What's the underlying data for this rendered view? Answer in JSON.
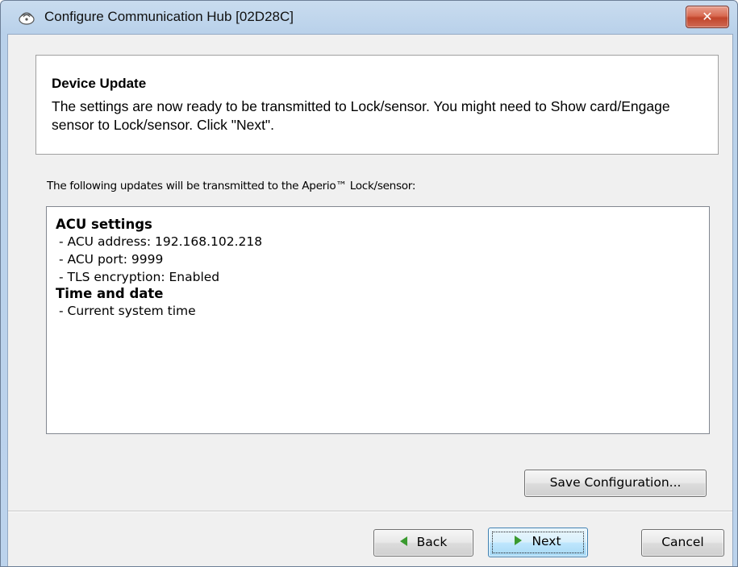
{
  "window": {
    "title": "Configure Communication Hub [02D28C]",
    "app_icon": "network-hub-icon",
    "close_icon": "close-icon",
    "close_glyph": "✕"
  },
  "header": {
    "title": "Device Update",
    "body": "The settings are now ready to be transmitted to Lock/sensor. You might need to Show card/Engage sensor to Lock/sensor. Click \"Next\"."
  },
  "intro_label": "The following updates will be transmitted to the Aperio™ Lock/sensor:",
  "updates": {
    "sections": [
      {
        "title": "ACU settings",
        "lines": [
          "- ACU address: 192.168.102.218",
          "- ACU port: 9999",
          "- TLS encryption: Enabled"
        ]
      },
      {
        "title": "Time and date",
        "lines": [
          "- Current system time"
        ]
      }
    ]
  },
  "buttons": {
    "save_configuration": "Save Configuration...",
    "back": "Back",
    "next": "Next",
    "cancel": "Cancel"
  },
  "colors": {
    "close_button": "#c9503a",
    "arrow_green": "#3a9a2f",
    "next_focus_border": "#3c7fb1"
  }
}
